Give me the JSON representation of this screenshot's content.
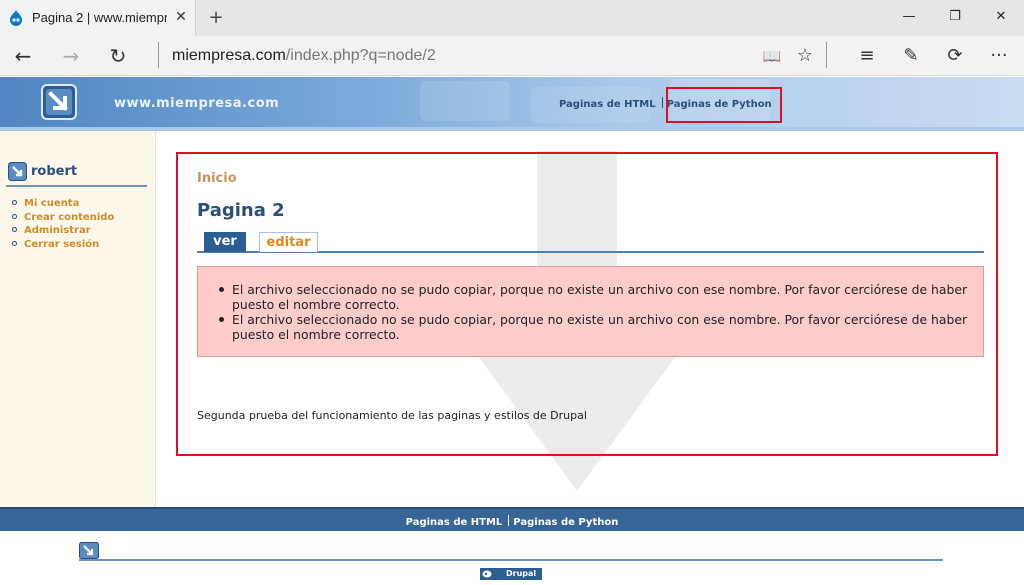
{
  "browser": {
    "tab_title": "Pagina 2 | www.miempresa.com",
    "tab_close": "✕",
    "new_tab": "+",
    "window_minimize": "—",
    "window_restore": "❐",
    "window_close": "✕",
    "url_host": "miempresa.com",
    "url_path": "/index.php?q=node/2",
    "back": "←",
    "forward": "→",
    "refresh": "↻",
    "reading_view": "📖",
    "favorite": "☆",
    "hub": "≡",
    "web_note": "✎",
    "share": "⟳",
    "more": "···"
  },
  "header": {
    "site_name": "www.miempresa.com",
    "primary_links": [
      "Paginas de HTML",
      "Paginas de Python"
    ]
  },
  "sidebar": {
    "user_name": "robert",
    "menu": [
      "Mi cuenta",
      "Crear contenido",
      "Administrar",
      "Cerrar sesión"
    ]
  },
  "main": {
    "breadcrumb": "Inicio",
    "title": "Pagina 2",
    "tabs": [
      "ver",
      "editar"
    ],
    "errors": [
      "El archivo seleccionado no se pudo copiar, porque no existe un archivo con ese nombre. Por favor cerciórese de haber puesto el nombre correcto.",
      "El archivo seleccionado no se pudo copiar, porque no existe un archivo con ese nombre. Por favor cerciórese de haber puesto el nombre correcto."
    ],
    "body": "Segunda prueba del funcionamiento de las paginas y estilos de Drupal"
  },
  "footer": {
    "links": [
      "Paginas de HTML",
      "Paginas de Python"
    ],
    "badge": "Drupal"
  },
  "colors": {
    "brand_blue": "#2b4f7a",
    "link_orange": "#d18a2a",
    "error_bg": "#ffcccc",
    "highlight_red": "#e01020"
  }
}
